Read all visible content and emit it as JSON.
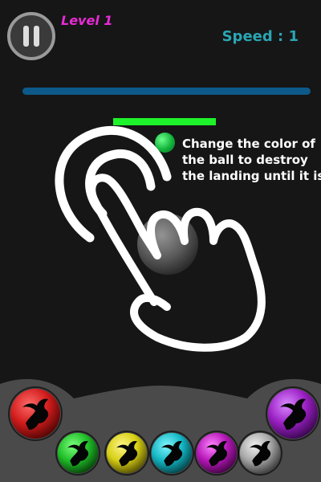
{
  "hud": {
    "level_label": "Level  1",
    "speed_label": "Speed : 1"
  },
  "tutorial": {
    "hint_lines": [
      "Change the color of",
      "the ball to destroy",
      "the landing until it is"
    ]
  },
  "colors": {
    "background": "#161616",
    "top_bar": "#0d5a8a",
    "landing": "#1ef22a",
    "current_ball": "#1fbf45",
    "level_text": "#e82bd6",
    "speed_text": "#2aa6b4",
    "balls": {
      "red": "#d21c1c",
      "purple": "#9b1fc4",
      "green": "#1fbd28",
      "yellow": "#d6cf14",
      "cyan": "#13b6c4",
      "magenta": "#b617b8",
      "gray": "#a8a8a8"
    }
  },
  "palette": {
    "icon": "dragon-icon",
    "balls": [
      "red",
      "purple",
      "green",
      "yellow",
      "cyan",
      "magenta",
      "gray"
    ]
  }
}
